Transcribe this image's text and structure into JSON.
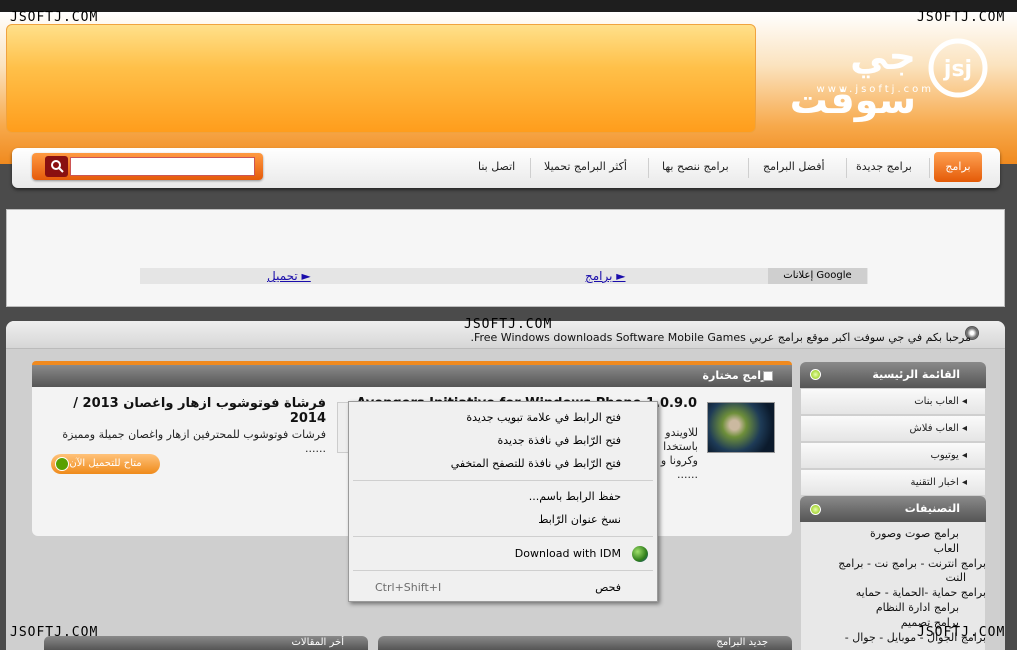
{
  "watermarks": [
    "JSOFTJ.COM",
    "JSOFTJ.COM",
    "JSOFTJ.COM",
    "JSOFTJ.COM",
    "JSOFTJ.COM"
  ],
  "logo": {
    "arabic": "جي سوفت",
    "url": "www.jsoftj.com"
  },
  "nav": {
    "active": "برامج",
    "items": [
      "برامج جديدة",
      "أفضل البرامج",
      "برامج ننصح بها",
      "أكثر البرامج تحميلا",
      "اتصل بنا"
    ]
  },
  "search": {
    "placeholder": "",
    "icon": "search-icon"
  },
  "ads": {
    "label": "إعلانات Google",
    "links": [
      "► برامج",
      "► تحميل"
    ]
  },
  "welcome": "مرحبا بكم في جي سوفت اكبر موقع برامج عربي Free Windows downloads Software Mobile Games.",
  "sidebar": {
    "main_menu_title": "القائمة الرئيسية",
    "main_menu": [
      "العاب بنات",
      "العاب فلاش",
      "يوتيوب",
      "اخبار التقنية"
    ],
    "categories_title": "التصنيفات",
    "categories": [
      "برامج صوت وصورة",
      "العاب",
      "برامج انترنت - برامج نت - برامج",
      "النت",
      "برامج حماية -الحماية - حمايه",
      "برامج ادارة النظام",
      "برامج تصميم",
      "برامج الجوال - موبايل - جوال -"
    ]
  },
  "featured": {
    "title": "برامج مختارة",
    "left_article": {
      "title": "فرشاة فوتوشوب ازهار واغصان 2013 / 2014",
      "desc": "فرشات فوتوشوب للمحترفين ازهار واغصان جميلة ومميزة ......",
      "download": "متاح للتحميل الآن"
    },
    "right_article": {
      "title": "Avengers Initiative for Windows Phone 1.0.9.0",
      "desc_lines": [
        "للاويندو",
        "باستخدا",
        "وكرونا و",
        "......"
      ]
    }
  },
  "bottom_panels": [
    "أخر المقالات",
    "جديد البرامج"
  ],
  "context_menu": {
    "items": [
      {
        "label": "فتح الرابط في علامة تبويب جديدة"
      },
      {
        "label": "فتح الرّابط في نافذة جديدة"
      },
      {
        "label": "فتح الرّابط في نافذة للتصفح المتخفي"
      },
      {
        "label": "حفظ الرابط باسم..."
      },
      {
        "label": "نسخ عنوان الرّابط"
      },
      {
        "label": "Download with IDM",
        "icon": "idm-icon"
      },
      {
        "label": "فحص",
        "shortcut": "Ctrl+Shift+I"
      }
    ]
  },
  "colors": {
    "accent": "#f08a1f",
    "header_dark": "#555555",
    "link": "#1a0dab"
  }
}
